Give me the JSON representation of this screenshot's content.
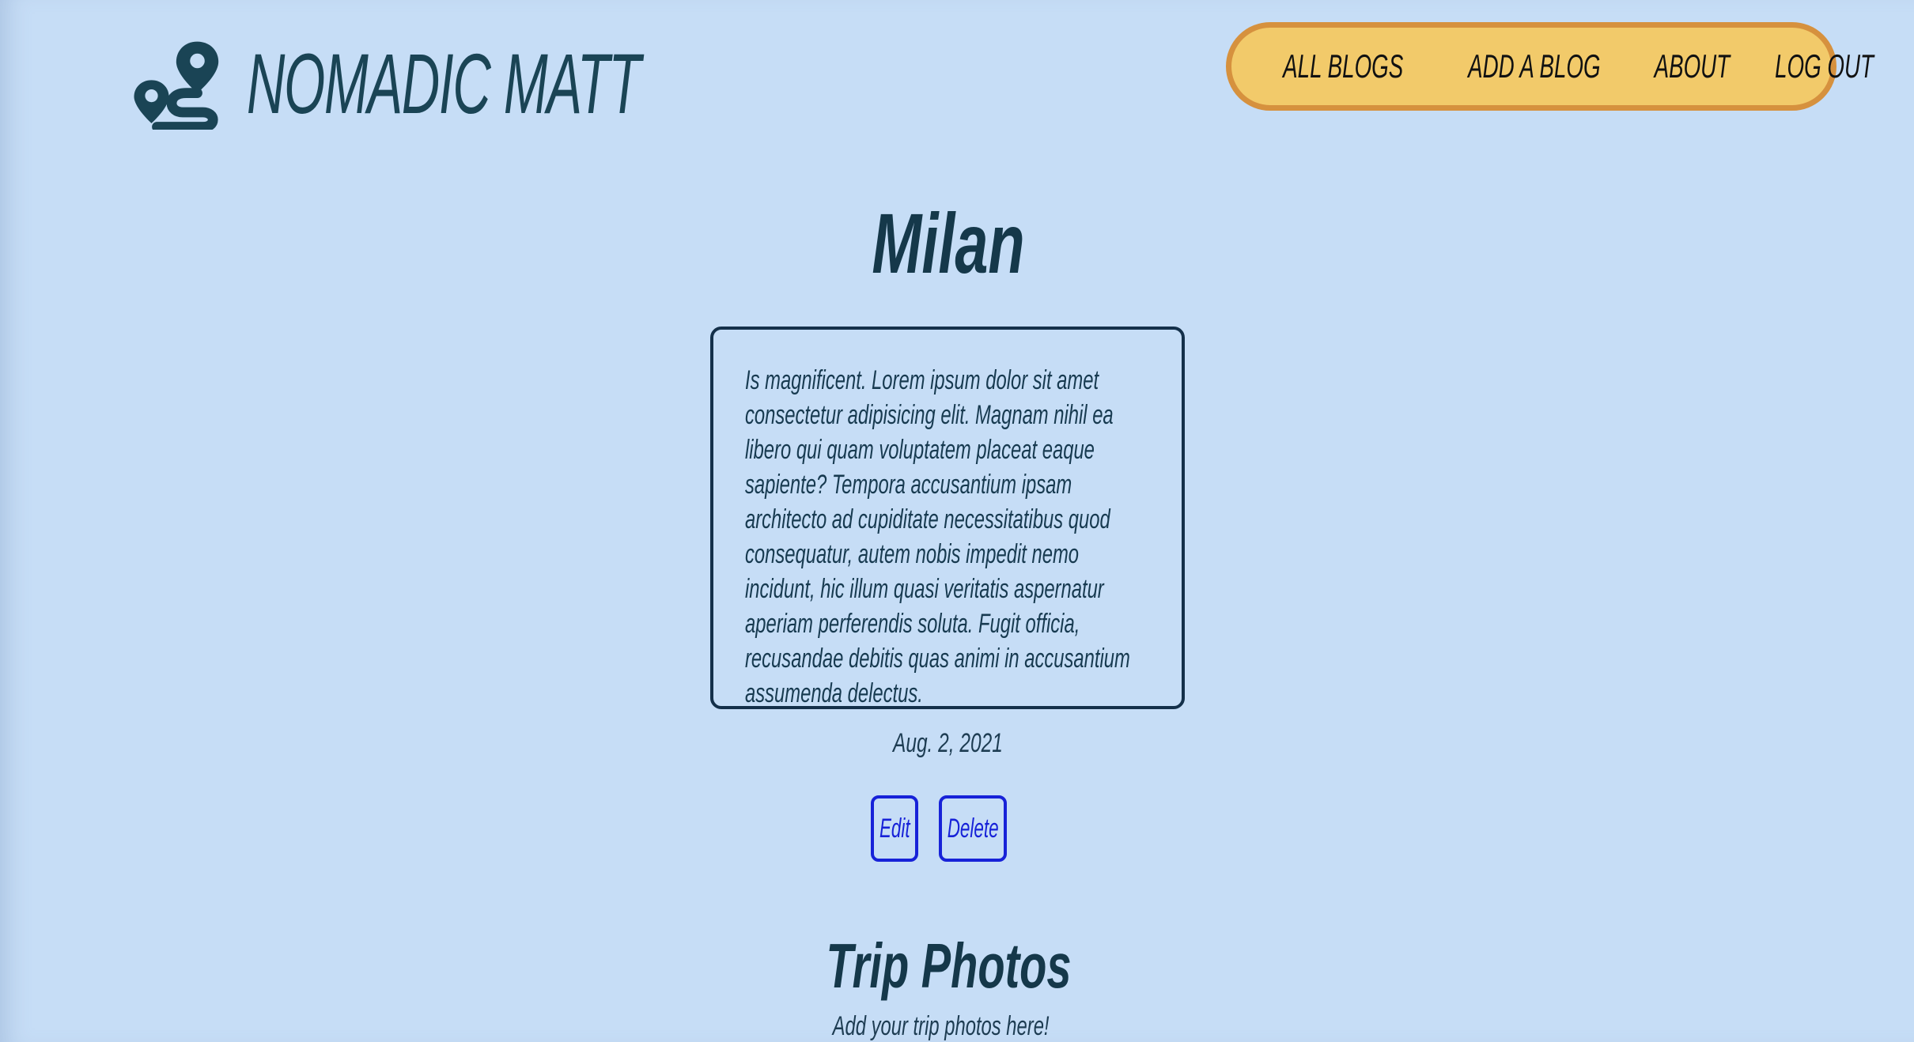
{
  "header": {
    "logo_icon": "route-pin-icon",
    "site_name": "NOMADIC MATT"
  },
  "nav": {
    "items": [
      {
        "label": "ALL BLOGS"
      },
      {
        "label": "ADD A BLOG"
      },
      {
        "label": "ABOUT"
      },
      {
        "label": "LOG OUT"
      }
    ]
  },
  "post": {
    "title": "Milan",
    "body": "Is magnificent. Lorem ipsum dolor sit amet consectetur adipisicing elit. Magnam nihil ea libero qui quam voluptatem placeat eaque sapiente? Tempora accusantium ipsam architecto ad cupiditate necessitatibus quod consequatur, autem nobis impedit nemo incidunt, hic illum quasi veritatis aspernatur aperiam perferendis soluta. Fugit officia, recusandae debitis quas animi in accusantium assumenda delectus.",
    "date": "Aug. 2, 2021",
    "edit_label": "Edit",
    "delete_label": "Delete"
  },
  "photos": {
    "heading": "Trip Photos",
    "subtitle": "Add your trip photos here!"
  },
  "colors": {
    "background": "#c6ddf6",
    "logo": "#1a4455",
    "nav_fill": "#f2ca6a",
    "nav_border": "#d6913e",
    "button_blue": "#1722d8",
    "box_border": "#14304a"
  }
}
